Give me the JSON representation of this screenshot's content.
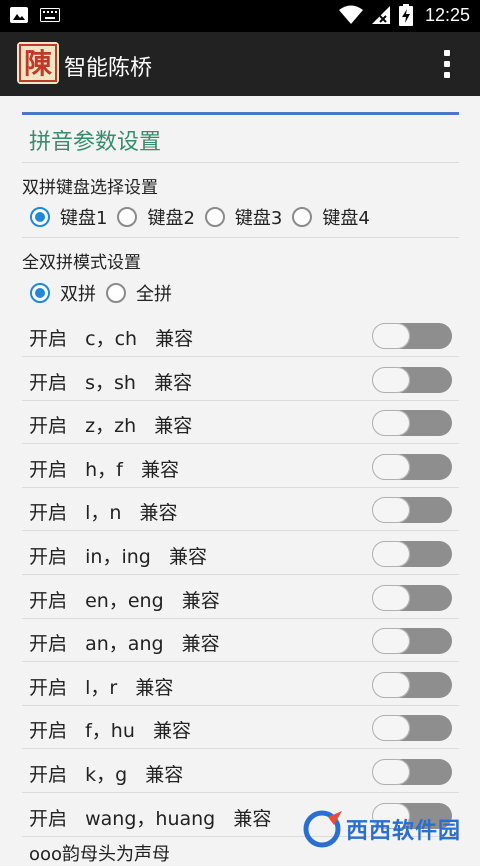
{
  "status_bar": {
    "time": "12:25",
    "left_icons": [
      "image-icon",
      "keyboard-icon"
    ],
    "right_icons": [
      "wifi-icon",
      "signal-icon",
      "battery-charging-icon"
    ]
  },
  "app_bar": {
    "title": "智能陈桥",
    "logo_glyph": "陳",
    "menu_icon": "overflow-menu-icon"
  },
  "section": {
    "title": "拼音参数设置"
  },
  "shuangpin_keyboard": {
    "label": "双拼键盘选择设置",
    "options": [
      {
        "label": "键盘1",
        "selected": true
      },
      {
        "label": "键盘2",
        "selected": false
      },
      {
        "label": "键盘3",
        "selected": false
      },
      {
        "label": "键盘4",
        "selected": false
      }
    ]
  },
  "mode": {
    "label": "全双拼模式设置",
    "options": [
      {
        "label": "双拼",
        "selected": true
      },
      {
        "label": "全拼",
        "selected": false
      }
    ]
  },
  "toggles": [
    {
      "label": "开启   c，ch   兼容",
      "on": false
    },
    {
      "label": "开启   s，sh   兼容",
      "on": false
    },
    {
      "label": "开启   z，zh   兼容",
      "on": false
    },
    {
      "label": "开启   h，f   兼容",
      "on": false
    },
    {
      "label": "开启   l，n   兼容",
      "on": false
    },
    {
      "label": "开启   in，ing   兼容",
      "on": false
    },
    {
      "label": "开启   en，eng   兼容",
      "on": false
    },
    {
      "label": "开启   an，ang   兼容",
      "on": false
    },
    {
      "label": "开启   l，r   兼容",
      "on": false
    },
    {
      "label": "开启   f，hu   兼容",
      "on": false
    },
    {
      "label": "开启   k，g   兼容",
      "on": false
    },
    {
      "label": "开启   wang，huang   兼容",
      "on": false
    }
  ],
  "partial_row_text": "ooo韵母头为声母",
  "watermark": "西西软件园",
  "colors": {
    "accent": "#1f88d9",
    "section_title": "#3a8a6e",
    "top_line": "#4a77c9",
    "app_bar": "#222222"
  }
}
